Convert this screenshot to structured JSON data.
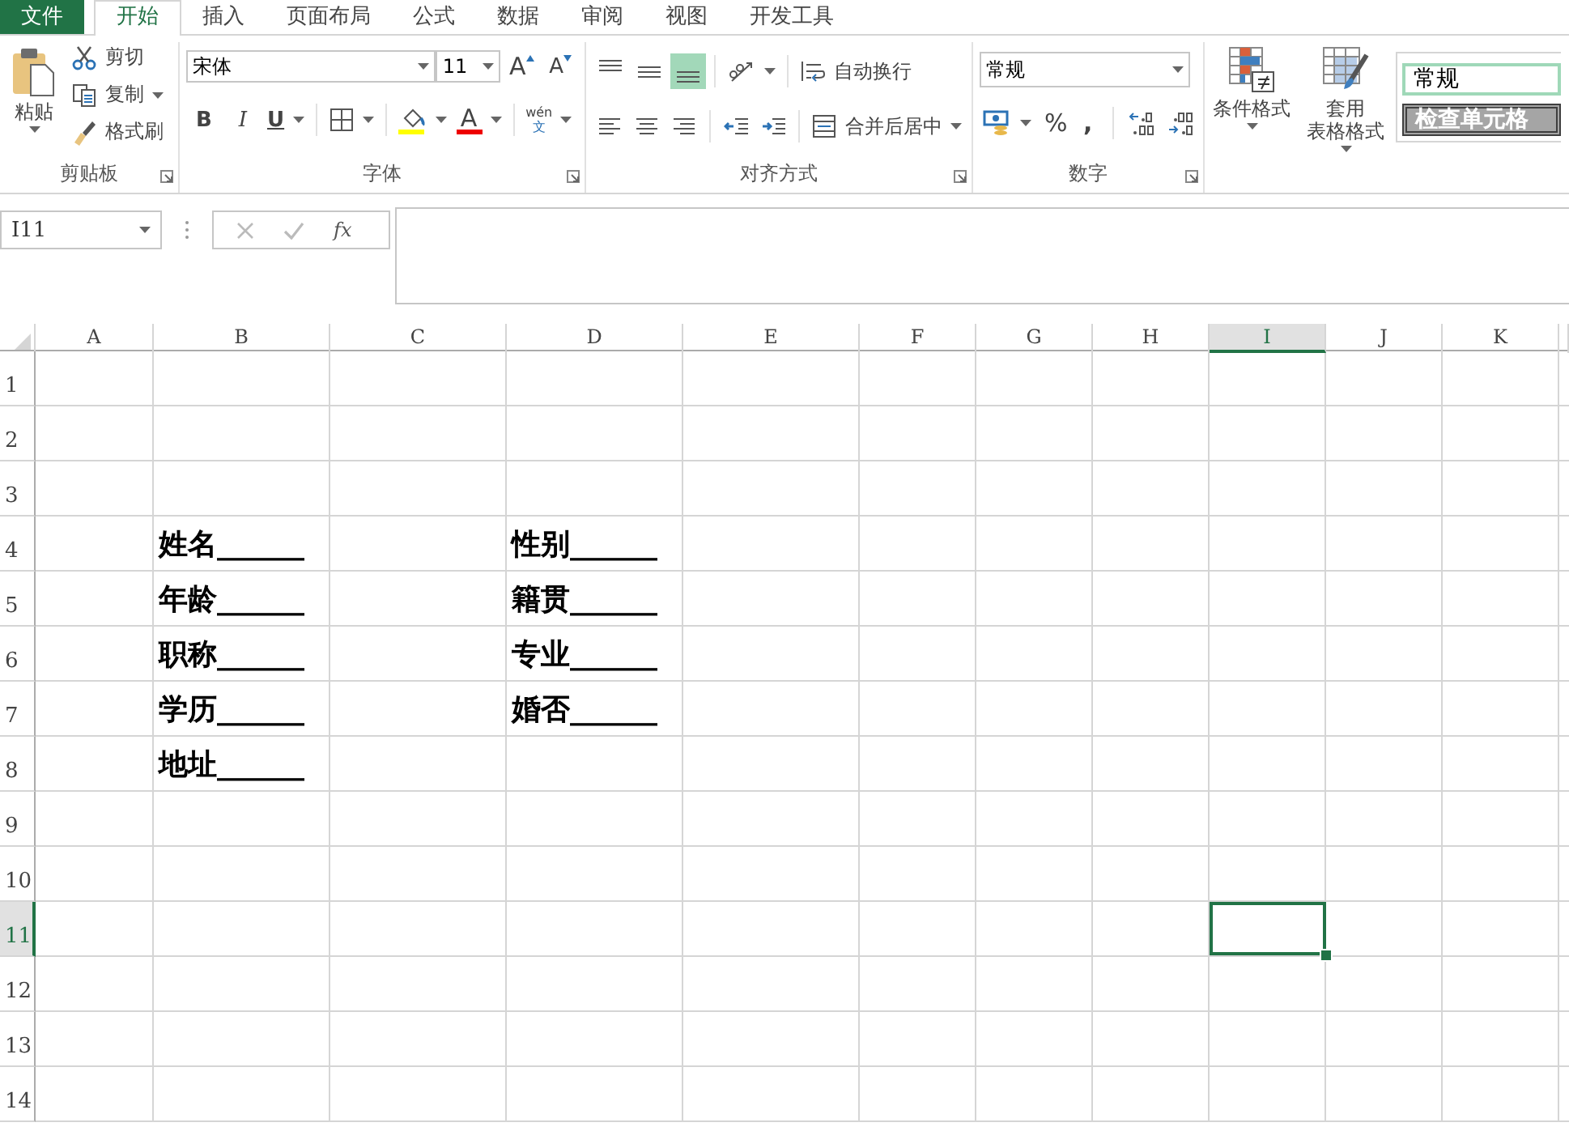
{
  "tabs": [
    {
      "label": "文件",
      "kind": "file",
      "selected": false
    },
    {
      "label": "开始",
      "kind": "tab",
      "selected": true
    },
    {
      "label": "插入",
      "kind": "tab",
      "selected": false
    },
    {
      "label": "页面布局",
      "kind": "tab",
      "selected": false
    },
    {
      "label": "公式",
      "kind": "tab",
      "selected": false
    },
    {
      "label": "数据",
      "kind": "tab",
      "selected": false
    },
    {
      "label": "审阅",
      "kind": "tab",
      "selected": false
    },
    {
      "label": "视图",
      "kind": "tab",
      "selected": false
    },
    {
      "label": "开发工具",
      "kind": "tab",
      "selected": false
    }
  ],
  "ribbon": {
    "clipboard": {
      "label": "剪贴板",
      "paste": "粘贴",
      "cut": "剪切",
      "copy": "复制",
      "format_painter": "格式刷"
    },
    "font": {
      "label": "字体",
      "name": "宋体",
      "size": "11",
      "grow": "A",
      "shrink": "A",
      "bold": "B",
      "italic": "I",
      "underline": "U",
      "font_color": "A",
      "phonetic_top": "wén",
      "phonetic_bottom": "文"
    },
    "alignment": {
      "label": "对齐方式",
      "vertical": [
        {
          "selected": false
        },
        {
          "selected": false
        },
        {
          "selected": true
        }
      ],
      "wrap_text": "自动换行",
      "merge_center": "合并后居中"
    },
    "number": {
      "label": "数字",
      "format": "常规",
      "percent": "%",
      "comma": ","
    },
    "styles": {
      "conditional": "条件格式",
      "table_line1": "套用",
      "table_line2": "表格格式",
      "cell_styles": [
        {
          "label": "常规",
          "kind": "normal"
        },
        {
          "label": "检查单元格",
          "kind": "check"
        }
      ]
    }
  },
  "formula_bar": {
    "name_box": "I11",
    "fx": "fx"
  },
  "sheet": {
    "columns": [
      {
        "label": "A",
        "selected": false
      },
      {
        "label": "B",
        "selected": false
      },
      {
        "label": "C",
        "selected": false
      },
      {
        "label": "D",
        "selected": false
      },
      {
        "label": "E",
        "selected": false
      },
      {
        "label": "F",
        "selected": false
      },
      {
        "label": "G",
        "selected": false
      },
      {
        "label": "H",
        "selected": false
      },
      {
        "label": "I",
        "selected": true
      },
      {
        "label": "J",
        "selected": false
      },
      {
        "label": "K",
        "selected": false
      }
    ],
    "rows": [
      {
        "label": "1",
        "selected": false
      },
      {
        "label": "2",
        "selected": false
      },
      {
        "label": "3",
        "selected": false
      },
      {
        "label": "4",
        "selected": false,
        "cells": {
          "B": "姓名______",
          "D": "性别______"
        }
      },
      {
        "label": "5",
        "selected": false,
        "cells": {
          "B": "年龄______",
          "D": "籍贯______"
        }
      },
      {
        "label": "6",
        "selected": false,
        "cells": {
          "B": "职称______",
          "D": "专业______"
        }
      },
      {
        "label": "7",
        "selected": false,
        "cells": {
          "B": "学历______",
          "D": "婚否______"
        }
      },
      {
        "label": "8",
        "selected": false,
        "cells": {
          "B": "地址______"
        }
      },
      {
        "label": "9",
        "selected": false
      },
      {
        "label": "10",
        "selected": false
      },
      {
        "label": "11",
        "selected": true
      },
      {
        "label": "12",
        "selected": false
      },
      {
        "label": "13",
        "selected": false
      },
      {
        "label": "14",
        "selected": false
      }
    ]
  }
}
